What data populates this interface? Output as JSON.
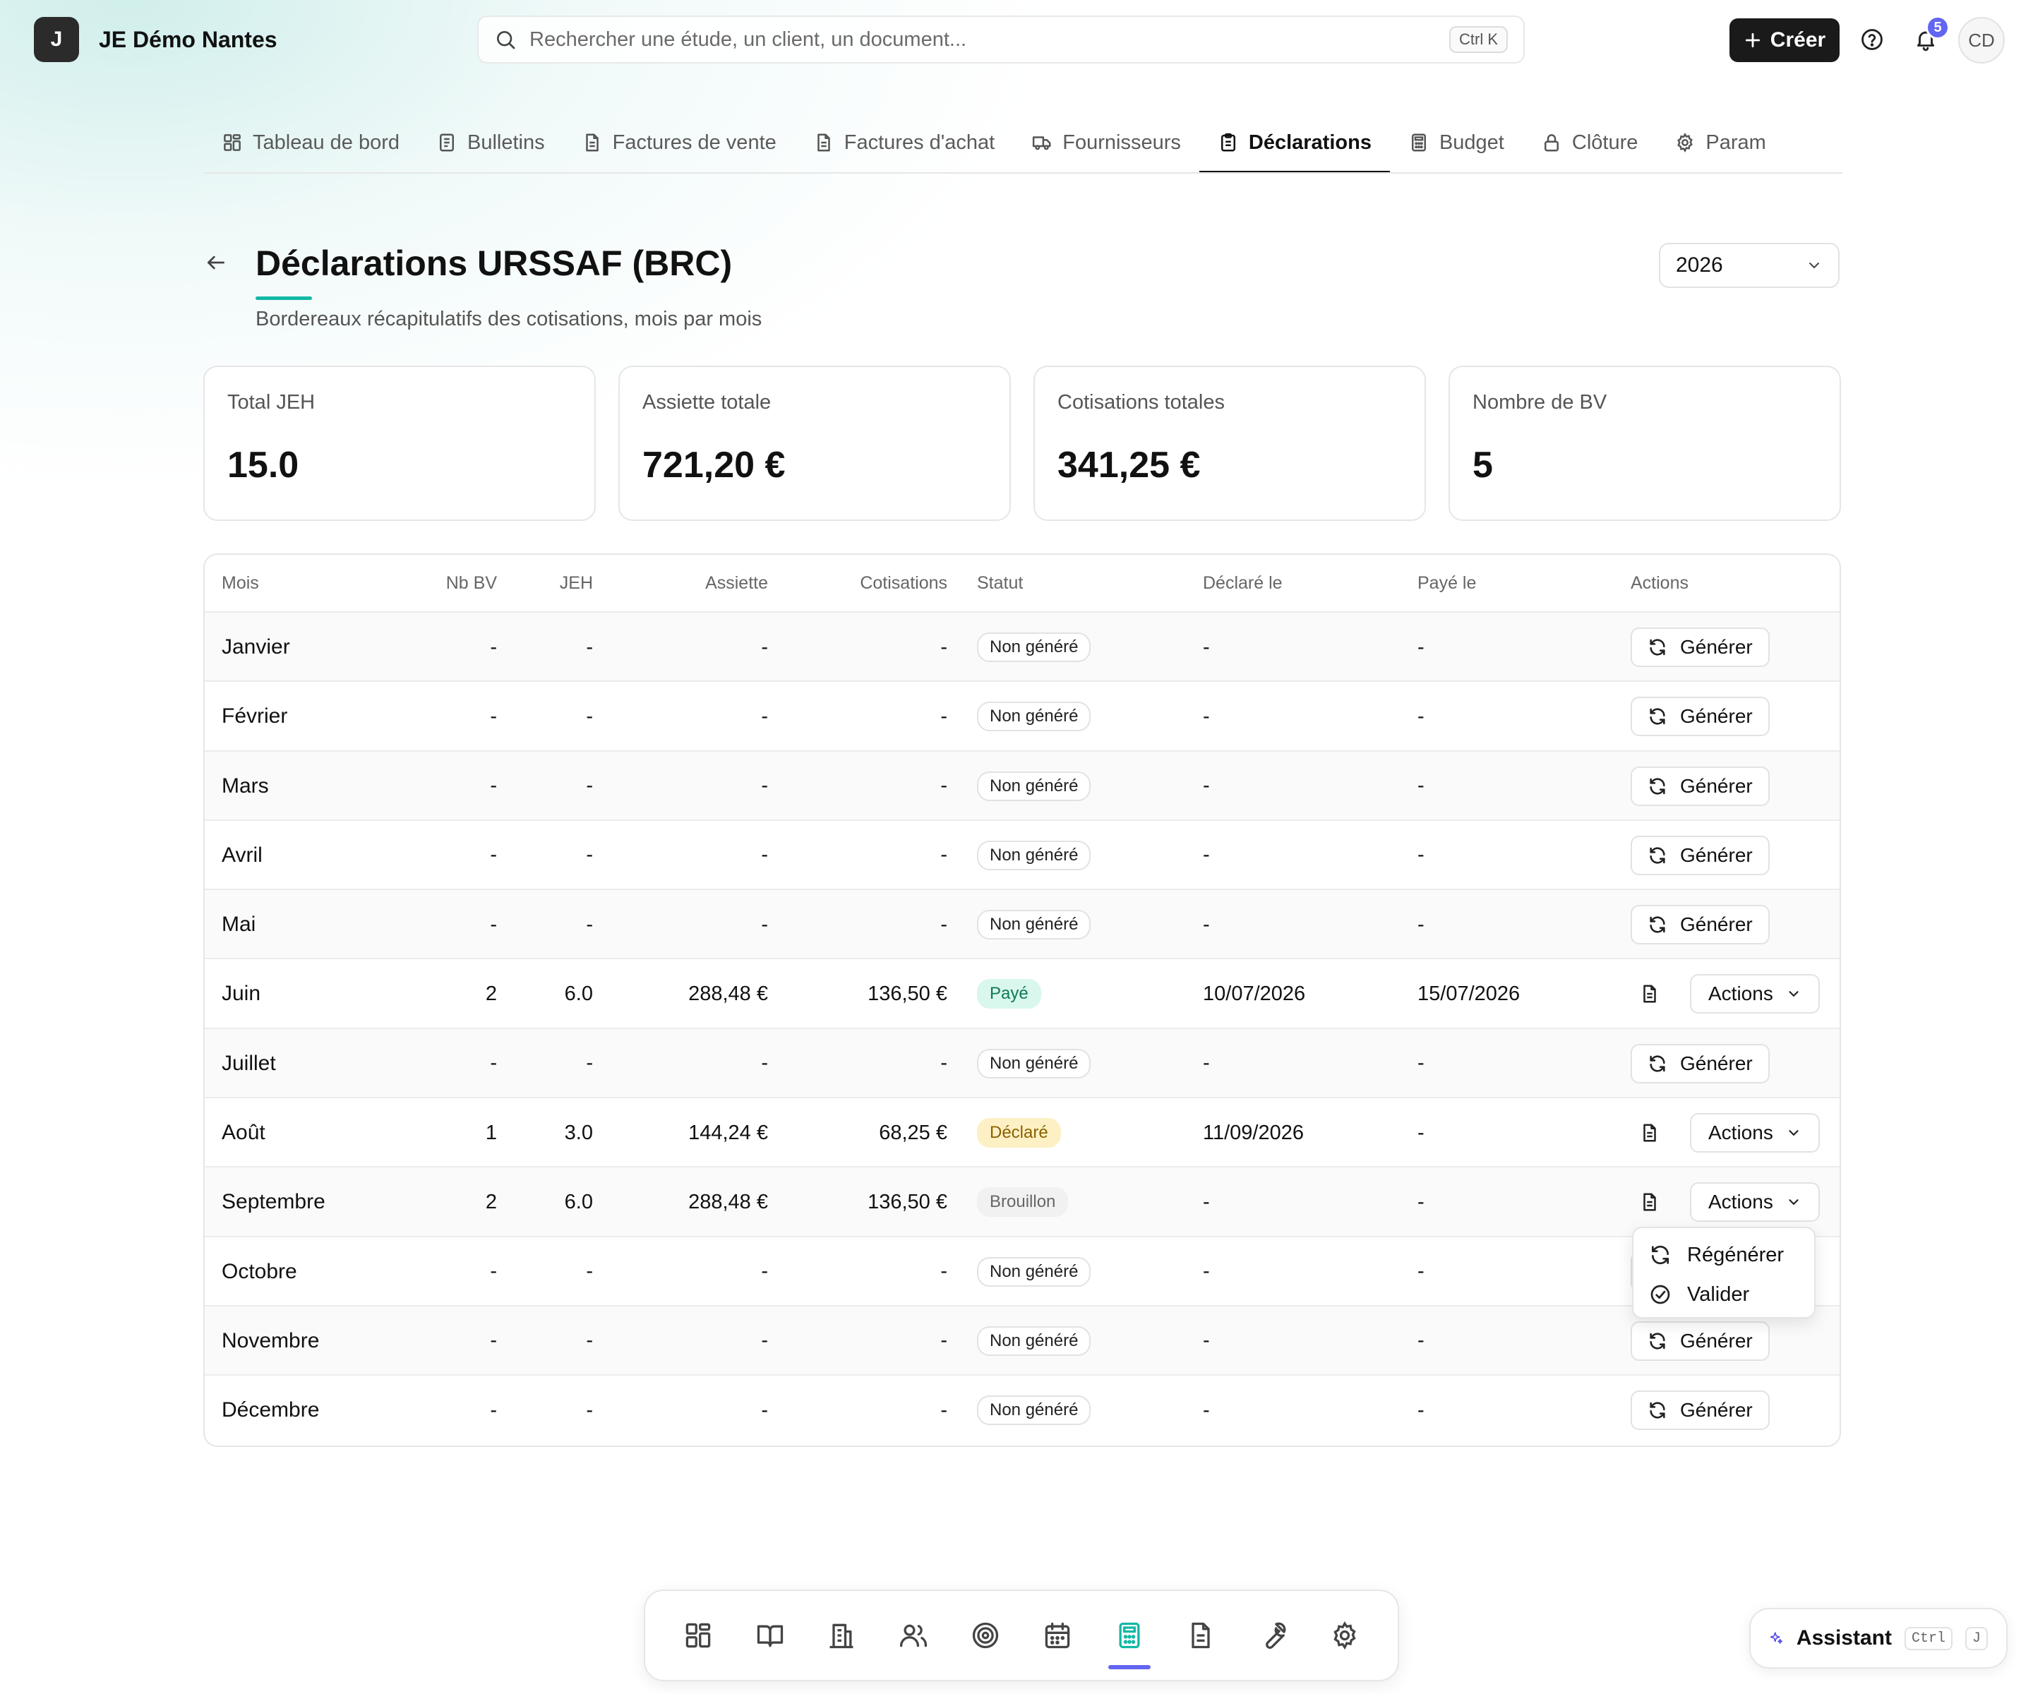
{
  "brand": {
    "logo_letter": "J",
    "name": "JE Démo Nantes"
  },
  "search": {
    "placeholder": "Rechercher une étude, un client, un document...",
    "shortcut": "Ctrl K"
  },
  "header": {
    "create_label": "Créer",
    "notification_count": "5",
    "avatar_initials": "CD"
  },
  "tabs": [
    {
      "label": "Tableau de bord",
      "icon": "dashboard-icon"
    },
    {
      "label": "Bulletins",
      "icon": "document-icon"
    },
    {
      "label": "Factures de vente",
      "icon": "file-icon"
    },
    {
      "label": "Factures d'achat",
      "icon": "file-icon"
    },
    {
      "label": "Fournisseurs",
      "icon": "truck-icon"
    },
    {
      "label": "Déclarations",
      "icon": "clipboard-icon",
      "active": true
    },
    {
      "label": "Budget",
      "icon": "calculator-icon"
    },
    {
      "label": "Clôture",
      "icon": "lock-icon"
    },
    {
      "label": "Param",
      "icon": "gear-icon"
    }
  ],
  "page": {
    "title": "Déclarations URSSAF (BRC)",
    "subtitle": "Bordereaux récapitulatifs des cotisations, mois par mois",
    "year": "2026"
  },
  "kpis": [
    {
      "label": "Total JEH",
      "value": "15.0"
    },
    {
      "label": "Assiette totale",
      "value": "721,20 €"
    },
    {
      "label": "Cotisations totales",
      "value": "341,25 €"
    },
    {
      "label": "Nombre de BV",
      "value": "5"
    }
  ],
  "table": {
    "headers": {
      "mois": "Mois",
      "nbbv": "Nb BV",
      "jeh": "JEH",
      "assiette": "Assiette",
      "cotisations": "Cotisations",
      "statut": "Statut",
      "declare": "Déclaré le",
      "paye": "Payé le",
      "actions": "Actions"
    },
    "generate_label": "Générer",
    "actions_label": "Actions",
    "rows": [
      {
        "mois": "Janvier",
        "nbbv": "-",
        "jeh": "-",
        "assiette": "-",
        "cotisations": "-",
        "statut": "Non généré",
        "declare": "-",
        "paye": "-",
        "action": "generate"
      },
      {
        "mois": "Février",
        "nbbv": "-",
        "jeh": "-",
        "assiette": "-",
        "cotisations": "-",
        "statut": "Non généré",
        "declare": "-",
        "paye": "-",
        "action": "generate"
      },
      {
        "mois": "Mars",
        "nbbv": "-",
        "jeh": "-",
        "assiette": "-",
        "cotisations": "-",
        "statut": "Non généré",
        "declare": "-",
        "paye": "-",
        "action": "generate"
      },
      {
        "mois": "Avril",
        "nbbv": "-",
        "jeh": "-",
        "assiette": "-",
        "cotisations": "-",
        "statut": "Non généré",
        "declare": "-",
        "paye": "-",
        "action": "generate"
      },
      {
        "mois": "Mai",
        "nbbv": "-",
        "jeh": "-",
        "assiette": "-",
        "cotisations": "-",
        "statut": "Non généré",
        "declare": "-",
        "paye": "-",
        "action": "generate"
      },
      {
        "mois": "Juin",
        "nbbv": "2",
        "jeh": "6.0",
        "assiette": "288,48 €",
        "cotisations": "136,50 €",
        "statut": "Payé",
        "declare": "10/07/2026",
        "paye": "15/07/2026",
        "action": "actions"
      },
      {
        "mois": "Juillet",
        "nbbv": "-",
        "jeh": "-",
        "assiette": "-",
        "cotisations": "-",
        "statut": "Non généré",
        "declare": "-",
        "paye": "-",
        "action": "generate"
      },
      {
        "mois": "Août",
        "nbbv": "1",
        "jeh": "3.0",
        "assiette": "144,24 €",
        "cotisations": "68,25 €",
        "statut": "Déclaré",
        "declare": "11/09/2026",
        "paye": "-",
        "action": "actions"
      },
      {
        "mois": "Septembre",
        "nbbv": "2",
        "jeh": "6.0",
        "assiette": "288,48 €",
        "cotisations": "136,50 €",
        "statut": "Brouillon",
        "declare": "-",
        "paye": "-",
        "action": "actions"
      },
      {
        "mois": "Octobre",
        "nbbv": "-",
        "jeh": "-",
        "assiette": "-",
        "cotisations": "-",
        "statut": "Non généré",
        "declare": "-",
        "paye": "-",
        "action": "generate"
      },
      {
        "mois": "Novembre",
        "nbbv": "-",
        "jeh": "-",
        "assiette": "-",
        "cotisations": "-",
        "statut": "Non généré",
        "declare": "-",
        "paye": "-",
        "action": "generate"
      },
      {
        "mois": "Décembre",
        "nbbv": "-",
        "jeh": "-",
        "assiette": "-",
        "cotisations": "-",
        "statut": "Non généré",
        "declare": "-",
        "paye": "-",
        "action": "generate"
      }
    ]
  },
  "dropdown": {
    "items": [
      {
        "label": "Régénérer",
        "icon": "refresh-icon"
      },
      {
        "label": "Valider",
        "icon": "check-circle-icon"
      }
    ]
  },
  "dock": {
    "items": [
      "dashboard-icon",
      "book-icon",
      "building-icon",
      "users-icon",
      "target-icon",
      "calendar-icon",
      "calculator-icon",
      "document-icon",
      "wrench-icon",
      "gear-icon"
    ],
    "active_index": 6,
    "active_color": "#6366f1"
  },
  "assistant": {
    "label": "Assistant",
    "key1": "Ctrl",
    "key2": "J"
  },
  "colors": {
    "accent_teal": "#14b8a6",
    "paid_bg": "#d9f7ec",
    "declared_bg": "#fdf0c4",
    "primary_dark": "#1a1a1a"
  }
}
